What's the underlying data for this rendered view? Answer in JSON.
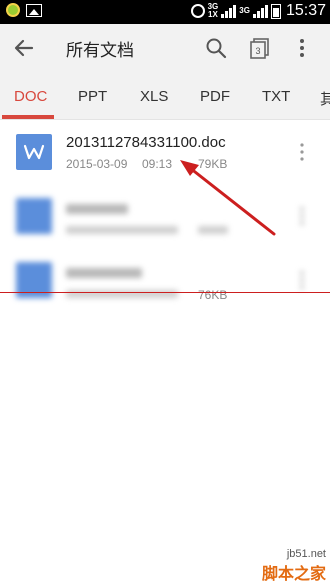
{
  "status_bar": {
    "network_top": "3G",
    "network_bottom": "1X",
    "network_top2": "3G",
    "time": "15:37"
  },
  "app_bar": {
    "title": "所有文档",
    "tab_count": "3"
  },
  "tabs": [
    {
      "label": "DOC",
      "active": true
    },
    {
      "label": "PPT",
      "active": false
    },
    {
      "label": "XLS",
      "active": false
    },
    {
      "label": "PDF",
      "active": false
    },
    {
      "label": "TXT",
      "active": false
    },
    {
      "label": "其",
      "active": false
    }
  ],
  "files": [
    {
      "name": "20131127843311​00.doc",
      "date": "2015-03-09",
      "time": "09:13",
      "size": "79KB",
      "icon": "word-icon"
    },
    {
      "name": "",
      "date": "",
      "time": "",
      "size": "",
      "icon": "doc-icon"
    },
    {
      "name": "",
      "date": "",
      "time": "",
      "size": "76KB",
      "icon": "doc-icon"
    }
  ],
  "watermark": {
    "site": "jb51.net",
    "name": "脚本之家"
  },
  "colors": {
    "accent": "#d8483d",
    "file_icon": "#5b8edb",
    "arrow": "#cc1f1f"
  }
}
